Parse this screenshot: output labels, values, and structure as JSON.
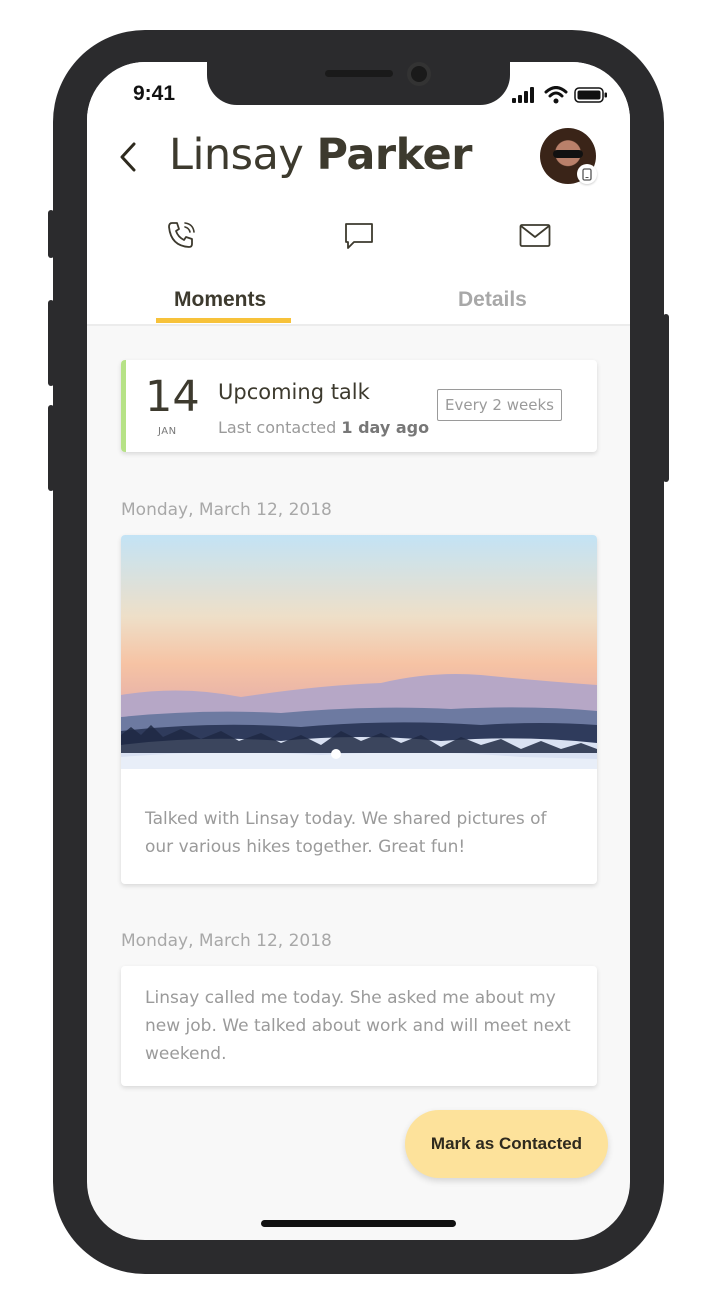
{
  "status": {
    "time": "9:41"
  },
  "header": {
    "first_name": "Linsay",
    "last_name": "Parker"
  },
  "actions": [
    "phone-call-icon",
    "chat-icon",
    "mail-icon"
  ],
  "tabs": [
    {
      "label": "Moments",
      "active": true
    },
    {
      "label": "Details",
      "active": false
    }
  ],
  "upcoming": {
    "day": "14",
    "month": "JAN",
    "title": "Upcoming talk",
    "sub_prefix": "Last contacted",
    "sub_value": "1 day ago",
    "frequency": "Every 2 weeks"
  },
  "moments": [
    {
      "date": "Monday, March 12, 2018",
      "text": "Talked with Linsay today. We shared pictures of our various hikes together. Great fun!"
    },
    {
      "date": "Monday, March 12, 2018",
      "text": "Linsay called me today. She asked me about my new job. We talked about work and will meet next weekend."
    }
  ],
  "fab": {
    "label": "Mark as Contacted"
  },
  "colors": {
    "accent": "#f7c23a",
    "upcoming_accent": "#b6e286",
    "fab_bg": "#fde29b",
    "title": "#3d3a2e"
  }
}
